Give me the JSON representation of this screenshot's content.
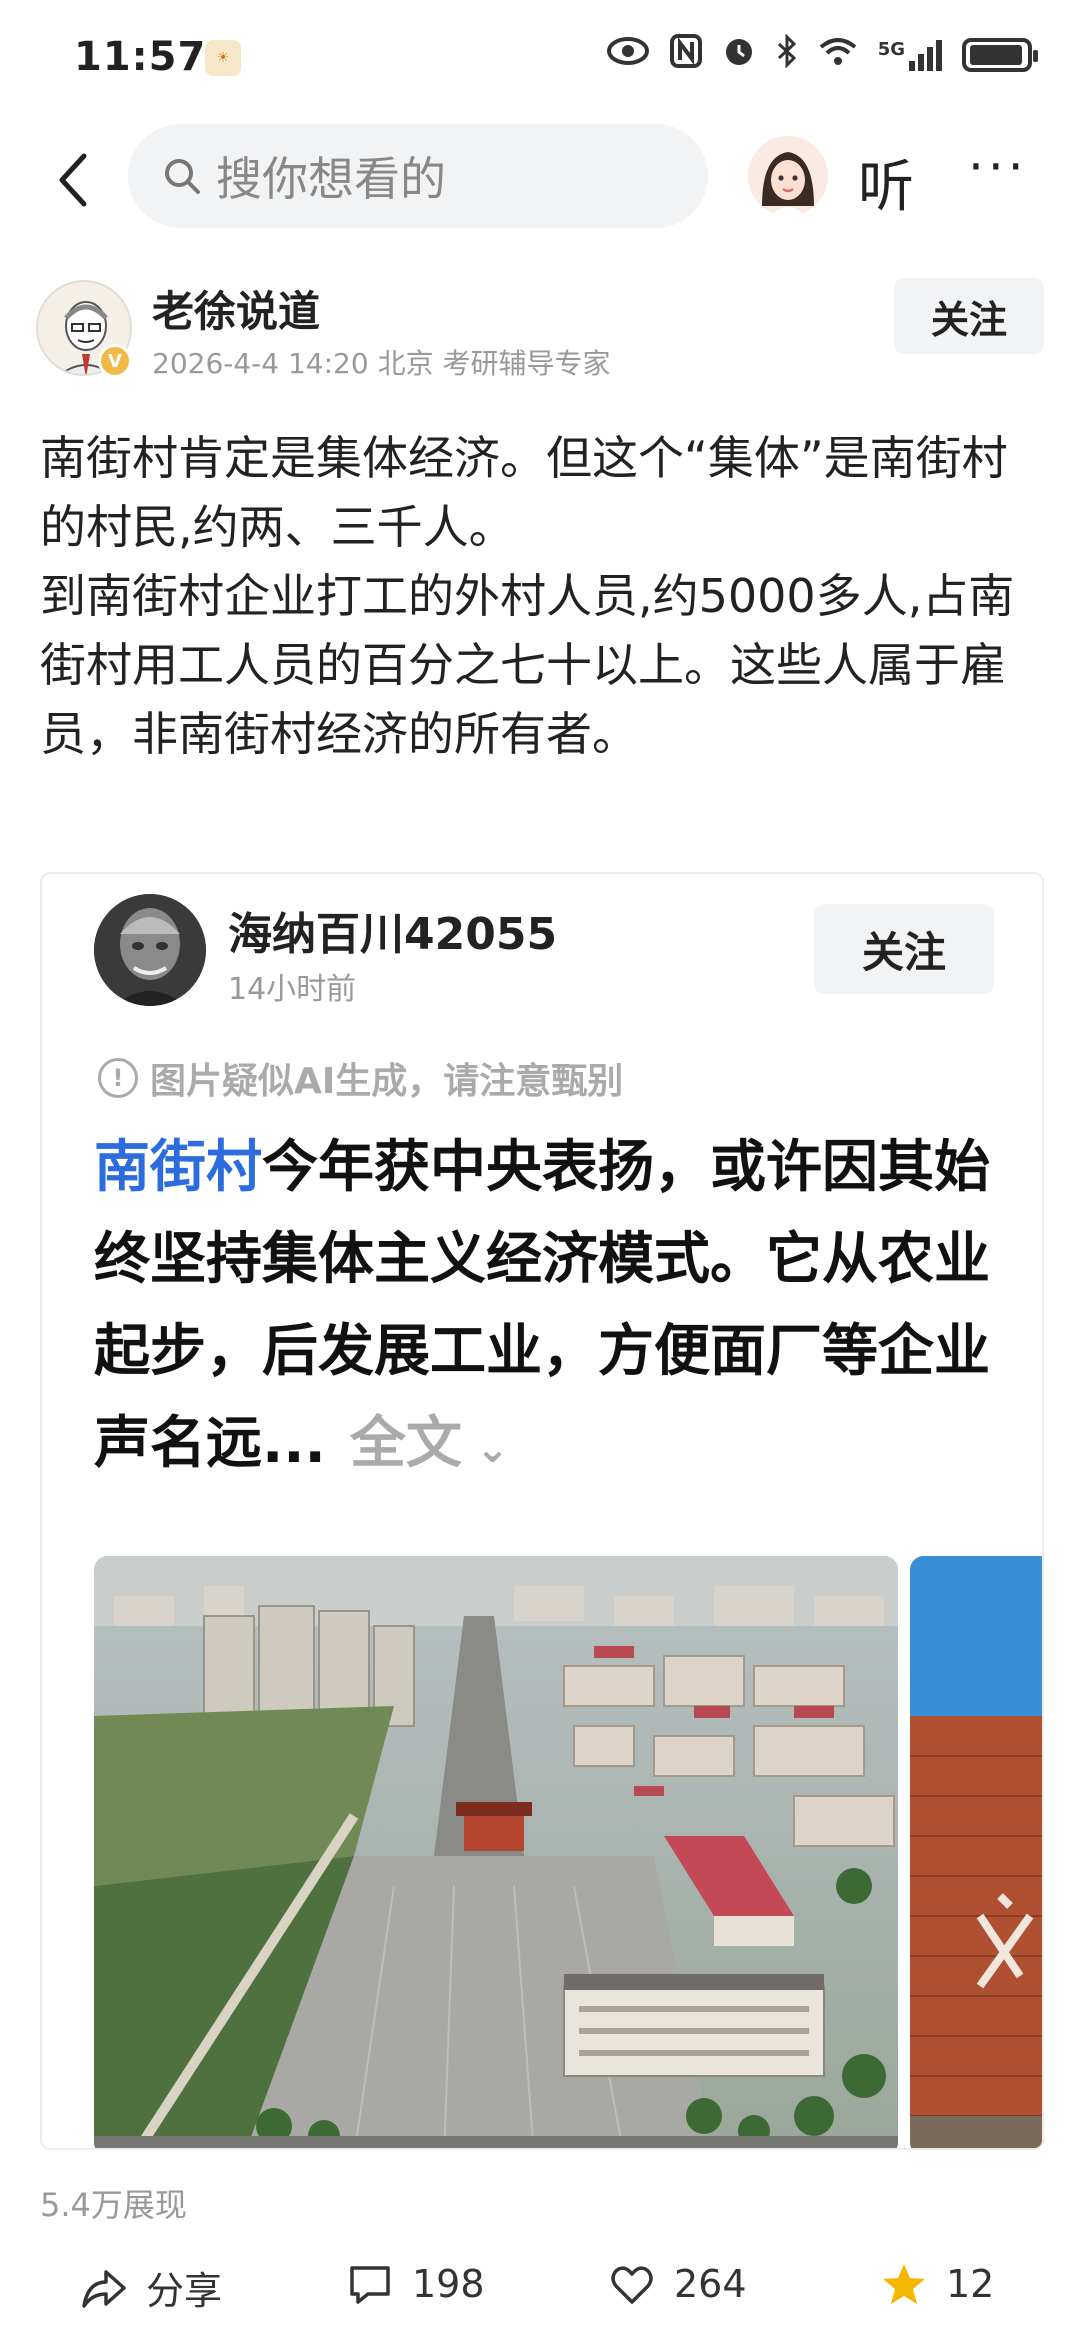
{
  "status_bar": {
    "time": "11:57",
    "network": "5G",
    "icons": [
      "eye-icon",
      "nfc-icon",
      "alarm-icon",
      "bluetooth-icon",
      "wifi-icon",
      "signal-icon",
      "battery-icon"
    ]
  },
  "nav": {
    "search_placeholder": "搜你想看的",
    "listen_label": "听",
    "more_label": "···"
  },
  "author": {
    "name": "老徐说道",
    "meta": "2026-4-4 14:20 北京 考研辅导专家",
    "follow_label": "关注",
    "verified_badge": "V"
  },
  "post": {
    "paragraph_1": "南街村肯定是集体经济。但这个“集体”是南街村的村民,约两、三千人。",
    "paragraph_2": "到南街村企业打工的外村人员,约5000多人,占南街村用工人员的百分之七十以上。这些人属于雇员，非南街村经济的所有者。"
  },
  "quoted": {
    "author_name": "海纳百川42055",
    "time": "14小时前",
    "follow_label": "关注",
    "ai_warning": "图片疑似AI生成，请注意甄别",
    "headline_highlight": "南街村",
    "headline_rest": "今年获中央表扬，或许因其始终坚持集体主义经济模式。它从农业起步，后发展工业，方便面厂等企业声名远...",
    "full_text_label": "全文"
  },
  "stats": {
    "views": "5.4万展现"
  },
  "actions": {
    "share_label": "分享",
    "comments": "198",
    "likes": "264",
    "favorites": "12"
  },
  "colors": {
    "accent_blue": "#2d6cdf",
    "star_gold": "#f2b705"
  }
}
